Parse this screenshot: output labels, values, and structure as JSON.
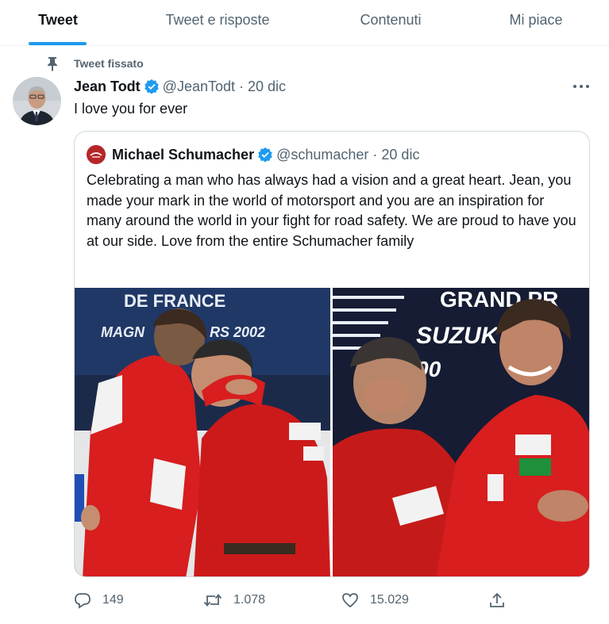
{
  "tabs": [
    {
      "label": "Tweet",
      "active": true
    },
    {
      "label": "Tweet e risposte",
      "active": false
    },
    {
      "label": "Contenuti",
      "active": false
    },
    {
      "label": "Mi piace",
      "active": false
    }
  ],
  "tweet": {
    "pinned_label": "Tweet fissato",
    "author_name": "Jean Todt",
    "handle": "@JeanTodt",
    "separator": "·",
    "date": "20 dic",
    "text": "I love you for ever",
    "more_icon": "more-horizontal-icon"
  },
  "quote": {
    "author_name": "Michael Schumacher",
    "handle": "@schumacher",
    "separator": "·",
    "date": "20 dic",
    "text": "Celebrating a man who has always had a vision and a great heart. Jean, you made your mark in the world of motorsport and you are an inspiration for many around the world in your fight for road safety. We are proud to have you at our side. Love from the entire Schumacher family",
    "photo_left_banner": {
      "line1": "DE FRANCE",
      "line2": "MAGN",
      "line3": "RS 2002"
    },
    "photo_right_banner": {
      "line1": "GRAND PR",
      "line2": "SUZUK",
      "line3": "00"
    }
  },
  "actions": {
    "reply_count": "149",
    "retweet_count": "1.078",
    "like_count": "15.029"
  },
  "colors": {
    "accent": "#1d9bf0",
    "secondary_text": "#536471",
    "border": "#cfd9de",
    "ferrari_red": "#d81e1e"
  }
}
